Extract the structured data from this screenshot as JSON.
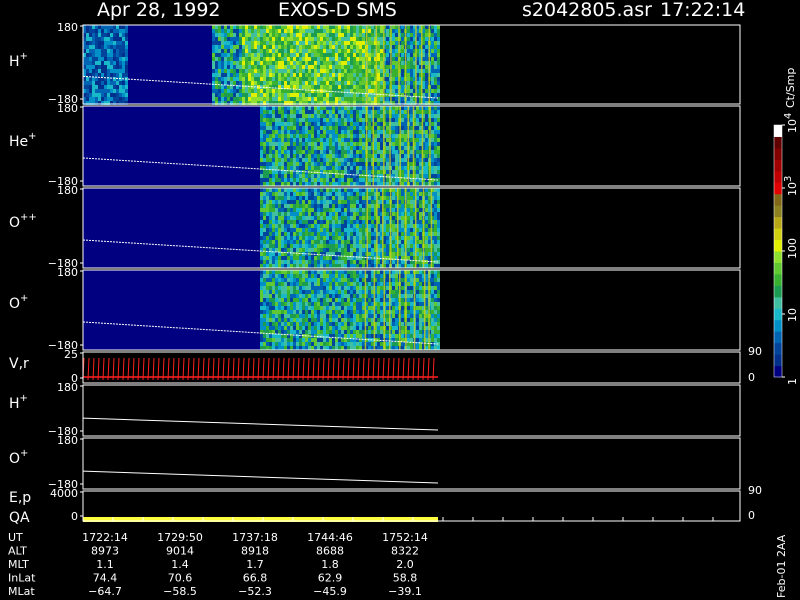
{
  "header": {
    "date": "Apr 28, 1992",
    "instrument": "EXOS-D SMS",
    "file": "s2042805.asr",
    "time": "17:22:14"
  },
  "chart_data": [
    {
      "type": "heatmap",
      "panel": "H+",
      "label": "H",
      "charge": "+",
      "y_ticks": [
        "180",
        "−180"
      ],
      "ylim": [
        -180,
        180
      ],
      "data_end_ut": "1752:14",
      "bands": [
        {
          "start_ut": "1722:14",
          "end_ut": "1726:00",
          "level": "low"
        },
        {
          "start_ut": "1733:00",
          "end_ut": "1735:30",
          "level": "medium"
        },
        {
          "start_ut": "1735:30",
          "end_ut": "1747:30",
          "level": "high"
        },
        {
          "start_ut": "1747:30",
          "end_ut": "1752:14",
          "level": "medium"
        }
      ]
    },
    {
      "type": "heatmap",
      "panel": "He+",
      "label": "He",
      "charge": "+",
      "y_ticks": [
        "180",
        "−180"
      ],
      "ylim": [
        -180,
        180
      ],
      "data_end_ut": "1752:14",
      "bands": [
        {
          "start_ut": "1722:14",
          "end_ut": "1737:00",
          "level": "background"
        },
        {
          "start_ut": "1737:00",
          "end_ut": "1752:14",
          "level": "medium"
        }
      ]
    },
    {
      "type": "heatmap",
      "panel": "O++",
      "label": "O",
      "charge": "++",
      "y_ticks": [
        "180",
        "−180"
      ],
      "ylim": [
        -180,
        180
      ],
      "data_end_ut": "1752:14",
      "bands": [
        {
          "start_ut": "1722:14",
          "end_ut": "1737:00",
          "level": "background"
        },
        {
          "start_ut": "1737:00",
          "end_ut": "1752:14",
          "level": "medium"
        }
      ]
    },
    {
      "type": "heatmap",
      "panel": "O+",
      "label": "O",
      "charge": "+",
      "y_ticks": [
        "180",
        "−180"
      ],
      "ylim": [
        -180,
        180
      ],
      "data_end_ut": "1752:14",
      "bands": [
        {
          "start_ut": "1722:14",
          "end_ut": "1737:00",
          "level": "background"
        },
        {
          "start_ut": "1737:00",
          "end_ut": "1752:14",
          "level": "medium"
        }
      ]
    },
    {
      "type": "line",
      "panel": "V,r",
      "label": "V,r",
      "y_ticks": [
        "25",
        "0"
      ],
      "right_ticks": [
        "90",
        "0"
      ],
      "ylim": [
        0,
        25
      ],
      "data_end_ut": "1752:14",
      "color": "#ff2020"
    },
    {
      "type": "line",
      "panel": "H+ attitude",
      "label": "H",
      "charge": "+",
      "y_ticks": [
        "180",
        "−180"
      ],
      "ylim": [
        -180,
        180
      ]
    },
    {
      "type": "line",
      "panel": "O+ attitude",
      "label": "O",
      "charge": "+",
      "y_ticks": [
        "180",
        "−180"
      ],
      "ylim": [
        -180,
        180
      ]
    },
    {
      "type": "bar",
      "panel": "E,p QA",
      "labels": [
        "E,p",
        "QA"
      ],
      "y_ticks": [
        "4000",
        "0"
      ],
      "right_ticks": [
        "90",
        "0"
      ],
      "qa_color": "#ffff40",
      "data_end_ut": "1752:14"
    }
  ],
  "colorbar": {
    "unit": "Ct/Smp",
    "ticks": [
      {
        "text": "1",
        "value": 1
      },
      {
        "text": "10",
        "value": 10
      },
      {
        "text": "100",
        "value": 100
      },
      {
        "base": "10",
        "exp": "3",
        "value": 1000
      },
      {
        "base": "10",
        "exp": "4",
        "value": 10000
      }
    ],
    "colors": [
      "#000080",
      "#00308c",
      "#00449c",
      "#0064b4",
      "#0090c8",
      "#18b8c8",
      "#40c0a0",
      "#1c9c50",
      "#38b030",
      "#60c830",
      "#90e030",
      "#e0f000",
      "#d0d010",
      "#b8a818",
      "#8c8020",
      "#806818",
      "#e00000",
      "#c00000",
      "#a00000",
      "#800000",
      "#600000",
      "#ffffff"
    ]
  },
  "footer": {
    "rows": [
      {
        "label": "UT",
        "values": [
          "1722:14",
          "1729:50",
          "1737:18",
          "1744:46",
          "1752:14"
        ]
      },
      {
        "label": "ALT",
        "values": [
          "8973",
          "9014",
          "8918",
          "8688",
          "8322"
        ]
      },
      {
        "label": "MLT",
        "values": [
          "1.1",
          "1.4",
          "1.7",
          "1.8",
          "2.0"
        ]
      },
      {
        "label": "InLat",
        "values": [
          "74.4",
          "70.6",
          "66.8",
          "62.9",
          "58.8"
        ]
      },
      {
        "label": "MLat",
        "values": [
          "−64.7",
          "−58.5",
          "−52.3",
          "−45.9",
          "−39.1"
        ]
      }
    ],
    "stamp": "Feb-01 2AA"
  }
}
